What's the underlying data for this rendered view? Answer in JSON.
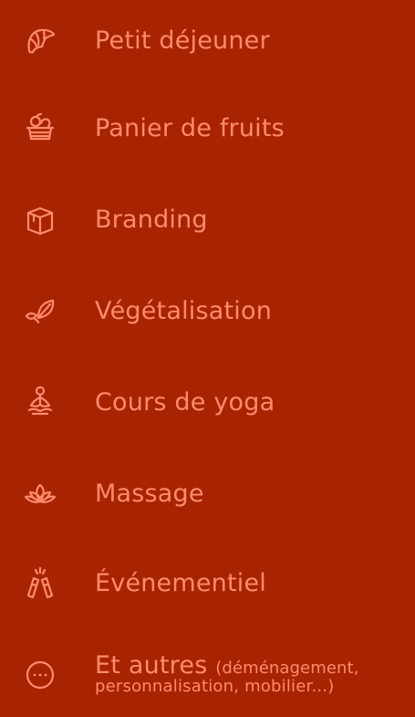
{
  "menu": {
    "items": [
      {
        "id": "petit-dejeuner",
        "label": "Petit déjeuner",
        "icon": "croissant-icon"
      },
      {
        "id": "panier-de-fruits",
        "label": "Panier de fruits",
        "icon": "fruit-basket-icon"
      },
      {
        "id": "branding",
        "label": "Branding",
        "icon": "box-icon"
      },
      {
        "id": "vegetalisation",
        "label": "Végétalisation",
        "icon": "leaf-icon"
      },
      {
        "id": "cours-de-yoga",
        "label": "Cours de yoga",
        "icon": "yoga-icon"
      },
      {
        "id": "massage",
        "label": "Massage",
        "icon": "lotus-icon"
      },
      {
        "id": "evenementiel",
        "label": "Événementiel",
        "icon": "champagne-toast-icon"
      },
      {
        "id": "et-autres",
        "label": "Et autres",
        "note_line1": "(déménagement,",
        "note_line2": "personnalisation, mobilier...)",
        "icon": "more-icon"
      }
    ]
  },
  "colors": {
    "background": "#a82300",
    "accent": "#ff8b6d"
  }
}
